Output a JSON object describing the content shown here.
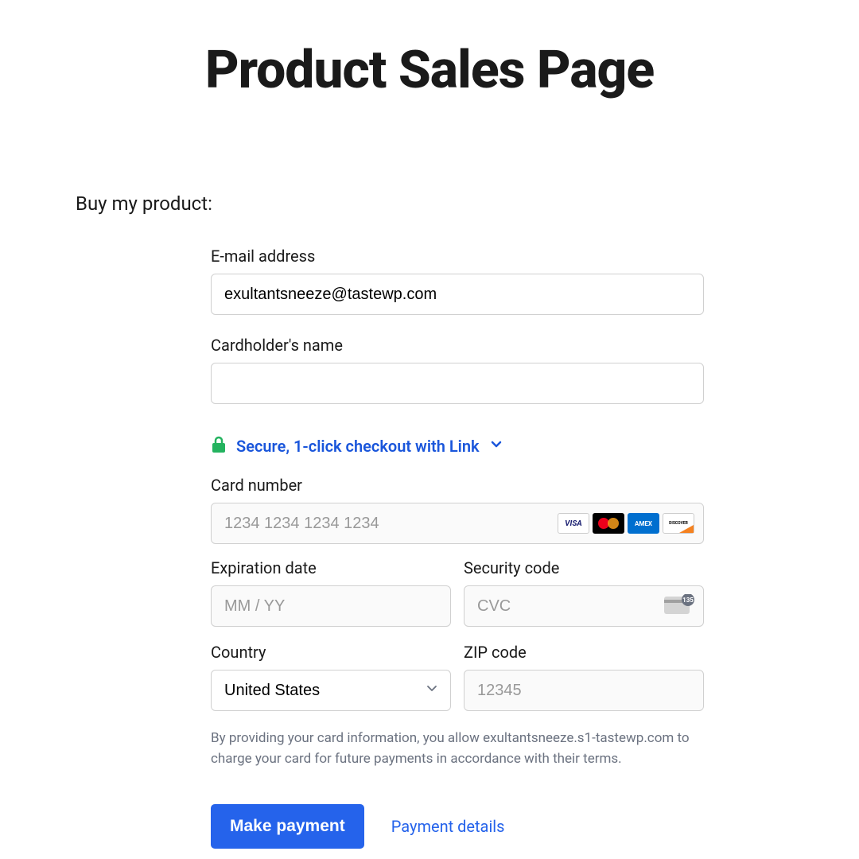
{
  "page": {
    "title": "Product Sales Page",
    "subtitle": "Buy my product:"
  },
  "form": {
    "email": {
      "label": "E-mail address",
      "value": "exultantsneeze@tastewp.com"
    },
    "cardholder": {
      "label": "Cardholder's name",
      "value": ""
    },
    "secure_link": "Secure, 1-click checkout with Link",
    "card_number": {
      "label": "Card number",
      "placeholder": "1234 1234 1234 1234",
      "brands": [
        "VISA",
        "mastercard",
        "AMEX",
        "DISCOVER"
      ]
    },
    "expiration": {
      "label": "Expiration date",
      "placeholder": "MM / YY"
    },
    "cvc": {
      "label": "Security code",
      "placeholder": "CVC",
      "badge": "135"
    },
    "country": {
      "label": "Country",
      "value": "United States"
    },
    "zip": {
      "label": "ZIP code",
      "placeholder": "12345"
    },
    "disclaimer": "By providing your card information, you allow exultantsneeze.s1-tastewp.com to charge your card for future payments in accordance with their terms."
  },
  "actions": {
    "submit": "Make payment",
    "details": "Payment details"
  }
}
